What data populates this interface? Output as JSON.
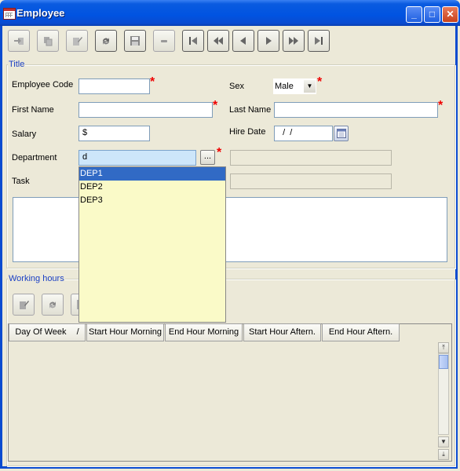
{
  "window": {
    "title": "Employee",
    "controls": [
      "_",
      "□",
      "✕"
    ]
  },
  "toolbar": {
    "buttons": [
      {
        "name": "import",
        "icon": "import-icon"
      },
      {
        "name": "copy",
        "icon": "copy-icon"
      },
      {
        "name": "edit",
        "icon": "edit-icon"
      },
      {
        "name": "reload",
        "icon": "reload-icon"
      },
      {
        "name": "save",
        "icon": "save-icon"
      },
      {
        "name": "delete",
        "icon": "delete-icon"
      },
      {
        "name": "first",
        "icon": "first-record-icon"
      },
      {
        "name": "previous-block",
        "icon": "fast-backward-icon"
      },
      {
        "name": "previous",
        "icon": "previous-icon"
      },
      {
        "name": "next",
        "icon": "next-icon"
      },
      {
        "name": "next-block",
        "icon": "fast-forward-icon"
      },
      {
        "name": "last",
        "icon": "last-record-icon"
      }
    ]
  },
  "title_section": {
    "legend": "Title",
    "employee_code": {
      "label": "Employee Code",
      "value": ""
    },
    "sex": {
      "label": "Sex",
      "value": "Male"
    },
    "first_name": {
      "label": "First Name",
      "value": ""
    },
    "last_name": {
      "label": "Last Name",
      "value": ""
    },
    "salary": {
      "label": "Salary",
      "value": "$"
    },
    "hire_date": {
      "label": "Hire Date",
      "value": "  /  /"
    },
    "department": {
      "label": "Department",
      "value": "d",
      "lookup_label": "...",
      "description": ""
    },
    "task": {
      "label": "Task",
      "value": "",
      "description": ""
    },
    "notes": ""
  },
  "department_dropdown": {
    "options": [
      "DEP1",
      "DEP2",
      "DEP3"
    ],
    "selected": 0
  },
  "working_hours": {
    "legend": "Working hours",
    "columns": [
      "Day Of Week",
      "Start Hour Morning",
      "End Hour Morning",
      "Start Hour Aftern.",
      "End Hour Aftern."
    ],
    "sort_indicator": "/"
  },
  "colors": {
    "accent": "#0a5be0",
    "selection": "#316ac5",
    "required": "#e00000",
    "dropdown_bg": "#fafac8",
    "legend": "#1a3fc4"
  }
}
